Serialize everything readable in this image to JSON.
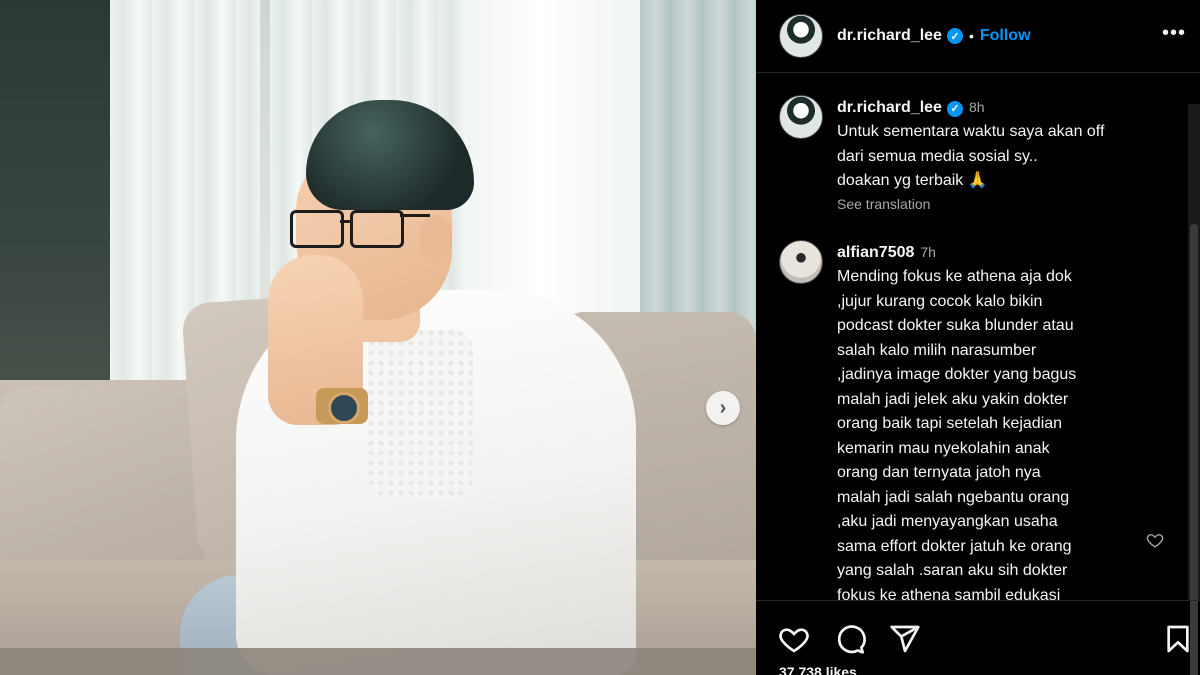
{
  "post": {
    "username": "dr.richard_lee",
    "verified_badge": "✓",
    "separator": "•",
    "follow_label": "Follow",
    "more_label": "•••"
  },
  "caption": {
    "username": "dr.richard_lee",
    "time": "8h",
    "lines": [
      "Untuk sementara waktu saya akan off",
      "dari semua media sosial sy..",
      "doakan yg terbaik 🙏"
    ],
    "see_translation": "See translation"
  },
  "comment": {
    "username": "alfian7508",
    "time": "7h",
    "lines": [
      "Mending fokus ke athena aja dok",
      ",jujur kurang cocok kalo bikin",
      "podcast dokter suka blunder atau",
      "salah kalo milih narasumber",
      ",jadinya image dokter yang bagus",
      "malah jadi jelek aku yakin dokter",
      "orang baik tapi setelah kejadian",
      "kemarin mau nyekolahin anak",
      "orang dan ternyata jatoh nya",
      "malah jadi salah ngebantu orang",
      ",aku jadi menyayangkan usaha",
      "sama effort dokter jatuh ke orang",
      "yang salah .saran aku sih dokter",
      "fokus ke athena sambil edukasi"
    ]
  },
  "media": {
    "next_label": "›"
  },
  "likes_text": "37,738 likes",
  "colors": {
    "accent": "#0095f6",
    "panel_bg": "#000000",
    "text": "#f5f5f5",
    "muted": "#a8a8a8"
  },
  "icons": [
    "heart-icon",
    "comment-icon",
    "share-icon",
    "bookmark-icon",
    "verified-icon",
    "more-icon",
    "chevron-right-icon"
  ]
}
